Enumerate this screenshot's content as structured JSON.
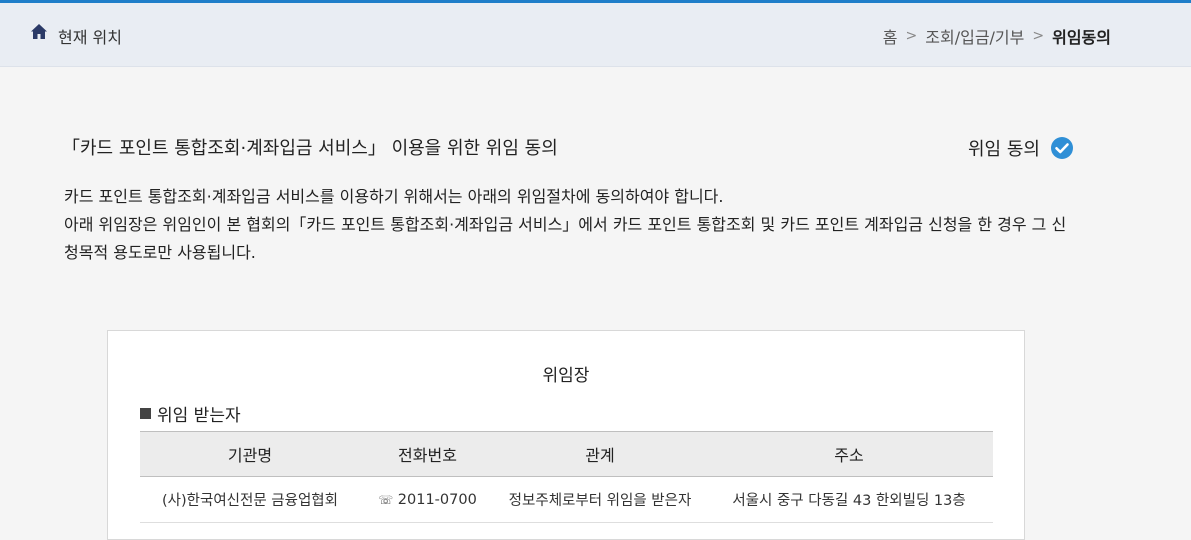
{
  "location": {
    "label": "현재 위치",
    "breadcrumb": [
      "홈",
      "조회/입금/기부",
      "위임동의"
    ]
  },
  "consent": {
    "title": "「카드 포인트 통합조회·계좌입금 서비스」 이용을 위한 위임 동의",
    "status_label": "위임 동의",
    "desc_line1": "카드 포인트 통합조회·계좌입금 서비스를 이용하기 위해서는 아래의 위임절차에 동의하여야 합니다.",
    "desc_line2": "아래 위임장은 위임인이 본 협회의「카드 포인트 통합조회·계좌입금 서비스」에서 카드 포인트 통합조회 및 카드 포인트 계좌입금 신청을 한 경우 그 신청목적 용도로만 사용됩니다."
  },
  "document": {
    "title": "위임장",
    "section_title": "위임 받는자",
    "table": {
      "headers": [
        "기관명",
        "전화번호",
        "관계",
        "주소"
      ],
      "rows": [
        {
          "org": "(사)한국여신전문 금융업협회",
          "phone_icon": "☏",
          "phone": "2011-0700",
          "relation": "정보주체로부터 위임을 받은자",
          "address": "서울시 중구 다동길 43 한외빌딩 13층"
        }
      ]
    }
  },
  "colors": {
    "accent": "#1f7ec9",
    "check": "#2f8fd6",
    "locbar": "#e9edf3"
  }
}
